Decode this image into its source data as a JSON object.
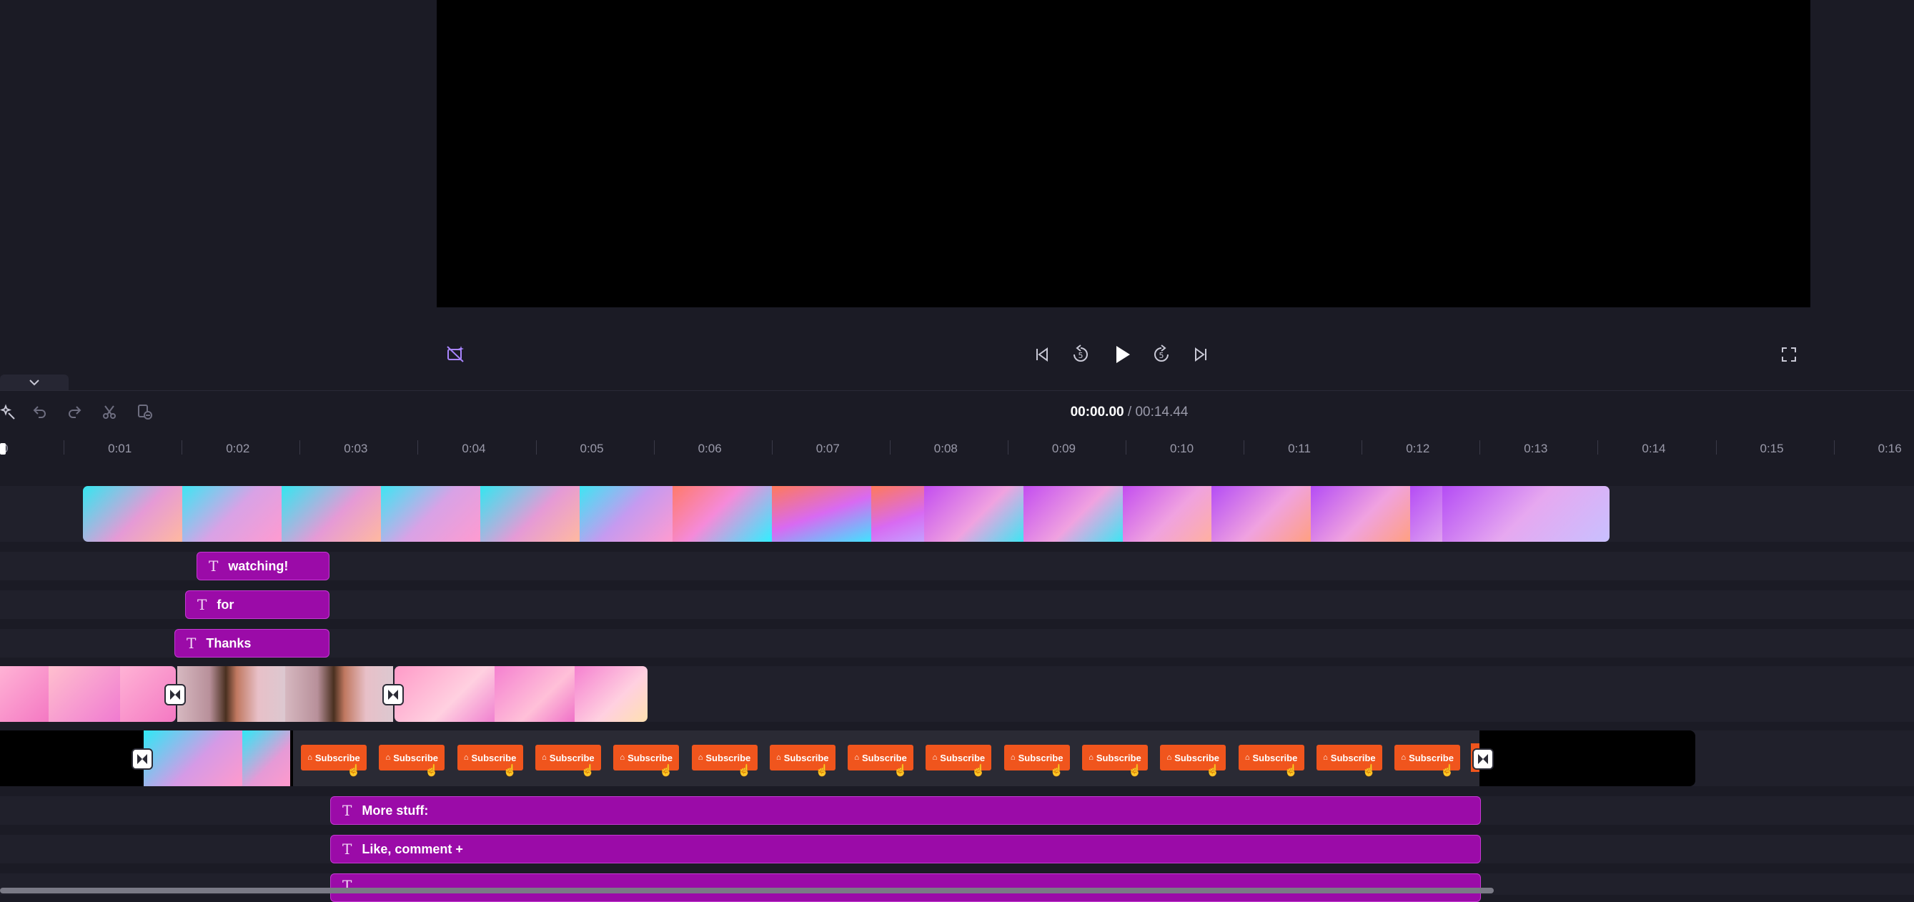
{
  "player": {
    "timecode_current": "00:00.00",
    "timecode_separator": " / ",
    "timecode_total": "00:14.44"
  },
  "ruler": {
    "ticks": [
      "0",
      "0:01",
      "0:02",
      "0:03",
      "0:04",
      "0:05",
      "0:06",
      "0:07",
      "0:08",
      "0:09",
      "0:10",
      "0:11",
      "0:12",
      "0:13",
      "0:14",
      "0:15",
      "0:16"
    ]
  },
  "text_clips": {
    "watching": "watching!",
    "for": "for",
    "thanks": "Thanks",
    "more_stuff": "More stuff:",
    "like_comment": "Like, comment +",
    "partial": "T"
  },
  "subscribe_label": "Subscribe",
  "colors": {
    "accent_purple": "#9b0ba8",
    "subscribe_orange": "#f0551d",
    "background": "#1b1b25"
  },
  "icons": {
    "magic": "magic-wand-icon",
    "undo": "undo-icon",
    "redo": "redo-icon",
    "split": "scissors-icon",
    "delete": "delete-clip-icon"
  }
}
